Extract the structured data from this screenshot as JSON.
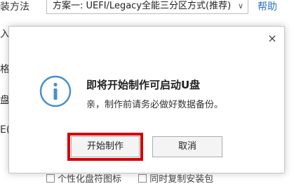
{
  "background": {
    "method_label": "装方法",
    "scheme_select_value": "方案一: UEFI/Legacy全能三分区方式(推荐)",
    "help_link": "帮助",
    "fragments": [
      "入",
      "格",
      "盘",
      "E(可"
    ],
    "options": [
      "个性化盘符图标",
      "同时复制安装包"
    ]
  },
  "dialog": {
    "close_label": "×",
    "title": "即将开始制作可启动U盘",
    "message": "亲，制作前请务必做好数据备份。",
    "start_button": "开始制作",
    "cancel_button": "取消",
    "icon": "info-icon",
    "highlight_color": "#d40000"
  }
}
